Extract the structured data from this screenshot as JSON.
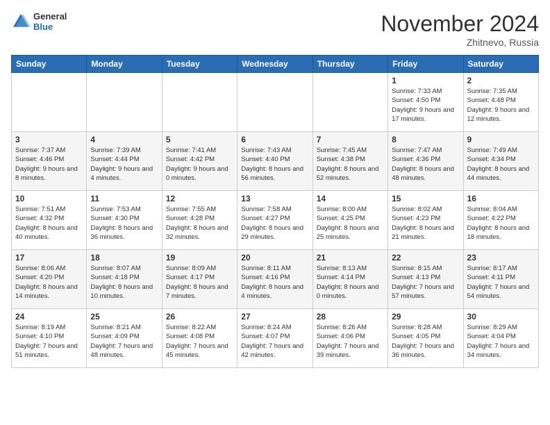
{
  "logo": {
    "general": "General",
    "blue": "Blue"
  },
  "header": {
    "title": "November 2024",
    "subtitle": "Zhitnevo, Russia"
  },
  "days_of_week": [
    "Sunday",
    "Monday",
    "Tuesday",
    "Wednesday",
    "Thursday",
    "Friday",
    "Saturday"
  ],
  "weeks": [
    [
      {
        "day": "",
        "info": ""
      },
      {
        "day": "",
        "info": ""
      },
      {
        "day": "",
        "info": ""
      },
      {
        "day": "",
        "info": ""
      },
      {
        "day": "",
        "info": ""
      },
      {
        "day": "1",
        "info": "Sunrise: 7:33 AM\nSunset: 4:50 PM\nDaylight: 9 hours and 17 minutes."
      },
      {
        "day": "2",
        "info": "Sunrise: 7:35 AM\nSunset: 4:48 PM\nDaylight: 9 hours and 12 minutes."
      }
    ],
    [
      {
        "day": "3",
        "info": "Sunrise: 7:37 AM\nSunset: 4:46 PM\nDaylight: 9 hours and 8 minutes."
      },
      {
        "day": "4",
        "info": "Sunrise: 7:39 AM\nSunset: 4:44 PM\nDaylight: 9 hours and 4 minutes."
      },
      {
        "day": "5",
        "info": "Sunrise: 7:41 AM\nSunset: 4:42 PM\nDaylight: 9 hours and 0 minutes."
      },
      {
        "day": "6",
        "info": "Sunrise: 7:43 AM\nSunset: 4:40 PM\nDaylight: 8 hours and 56 minutes."
      },
      {
        "day": "7",
        "info": "Sunrise: 7:45 AM\nSunset: 4:38 PM\nDaylight: 8 hours and 52 minutes."
      },
      {
        "day": "8",
        "info": "Sunrise: 7:47 AM\nSunset: 4:36 PM\nDaylight: 8 hours and 48 minutes."
      },
      {
        "day": "9",
        "info": "Sunrise: 7:49 AM\nSunset: 4:34 PM\nDaylight: 8 hours and 44 minutes."
      }
    ],
    [
      {
        "day": "10",
        "info": "Sunrise: 7:51 AM\nSunset: 4:32 PM\nDaylight: 8 hours and 40 minutes."
      },
      {
        "day": "11",
        "info": "Sunrise: 7:53 AM\nSunset: 4:30 PM\nDaylight: 8 hours and 36 minutes."
      },
      {
        "day": "12",
        "info": "Sunrise: 7:55 AM\nSunset: 4:28 PM\nDaylight: 8 hours and 32 minutes."
      },
      {
        "day": "13",
        "info": "Sunrise: 7:58 AM\nSunset: 4:27 PM\nDaylight: 8 hours and 29 minutes."
      },
      {
        "day": "14",
        "info": "Sunrise: 8:00 AM\nSunset: 4:25 PM\nDaylight: 8 hours and 25 minutes."
      },
      {
        "day": "15",
        "info": "Sunrise: 8:02 AM\nSunset: 4:23 PM\nDaylight: 8 hours and 21 minutes."
      },
      {
        "day": "16",
        "info": "Sunrise: 8:04 AM\nSunset: 4:22 PM\nDaylight: 8 hours and 18 minutes."
      }
    ],
    [
      {
        "day": "17",
        "info": "Sunrise: 8:06 AM\nSunset: 4:20 PM\nDaylight: 8 hours and 14 minutes."
      },
      {
        "day": "18",
        "info": "Sunrise: 8:07 AM\nSunset: 4:18 PM\nDaylight: 8 hours and 10 minutes."
      },
      {
        "day": "19",
        "info": "Sunrise: 8:09 AM\nSunset: 4:17 PM\nDaylight: 8 hours and 7 minutes."
      },
      {
        "day": "20",
        "info": "Sunrise: 8:11 AM\nSunset: 4:16 PM\nDaylight: 8 hours and 4 minutes."
      },
      {
        "day": "21",
        "info": "Sunrise: 8:13 AM\nSunset: 4:14 PM\nDaylight: 8 hours and 0 minutes."
      },
      {
        "day": "22",
        "info": "Sunrise: 8:15 AM\nSunset: 4:13 PM\nDaylight: 7 hours and 57 minutes."
      },
      {
        "day": "23",
        "info": "Sunrise: 8:17 AM\nSunset: 4:11 PM\nDaylight: 7 hours and 54 minutes."
      }
    ],
    [
      {
        "day": "24",
        "info": "Sunrise: 8:19 AM\nSunset: 4:10 PM\nDaylight: 7 hours and 51 minutes."
      },
      {
        "day": "25",
        "info": "Sunrise: 8:21 AM\nSunset: 4:09 PM\nDaylight: 7 hours and 48 minutes."
      },
      {
        "day": "26",
        "info": "Sunrise: 8:22 AM\nSunset: 4:08 PM\nDaylight: 7 hours and 45 minutes."
      },
      {
        "day": "27",
        "info": "Sunrise: 8:24 AM\nSunset: 4:07 PM\nDaylight: 7 hours and 42 minutes."
      },
      {
        "day": "28",
        "info": "Sunrise: 8:26 AM\nSunset: 4:06 PM\nDaylight: 7 hours and 39 minutes."
      },
      {
        "day": "29",
        "info": "Sunrise: 8:28 AM\nSunset: 4:05 PM\nDaylight: 7 hours and 36 minutes."
      },
      {
        "day": "30",
        "info": "Sunrise: 8:29 AM\nSunset: 4:04 PM\nDaylight: 7 hours and 34 minutes."
      }
    ]
  ]
}
